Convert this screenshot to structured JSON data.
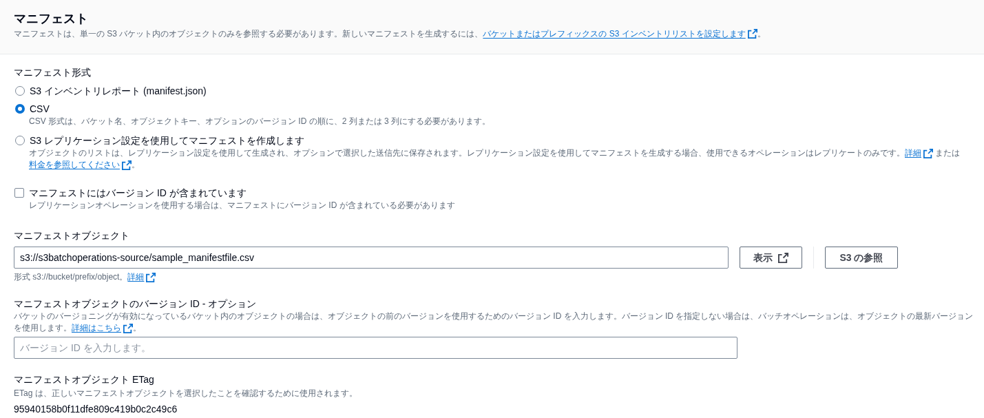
{
  "header": {
    "title": "マニフェスト",
    "description": [
      {
        "kind": "text",
        "text": "マニフェストは、単一の S3 バケット内のオブジェクトのみを参照する必要があります。新しいマニフェストを生成するには、"
      },
      {
        "kind": "link",
        "text": "バケットまたはプレフィックスの S3 インベントリリストを設定します"
      },
      {
        "kind": "text",
        "text": "。"
      }
    ]
  },
  "manifest_format": {
    "label": "マニフェスト形式",
    "options": [
      {
        "label": "S3 インベントリレポート (manifest.json)",
        "selected": false
      },
      {
        "label": "CSV",
        "selected": true,
        "description": [
          {
            "kind": "text",
            "text": "CSV 形式は、バケット名、オブジェクトキー、オプションのバージョン ID の順に、2 列または 3 列にする必要があります。"
          }
        ]
      },
      {
        "label": "S3 レプリケーション設定を使用してマニフェストを作成します",
        "selected": false,
        "description": [
          {
            "kind": "text",
            "text": "オブジェクトのリストは、レプリケーション設定を使用して生成され、オプションで選択した送信先に保存されます。レプリケーション設定を使用してマニフェストを生成する場合、使用できるオペレーションはレプリケートのみです。"
          },
          {
            "kind": "link",
            "text": "詳細"
          },
          {
            "kind": "text",
            "text": " または "
          },
          {
            "kind": "link",
            "text": "料金を参照してください"
          },
          {
            "kind": "text",
            "text": "。"
          }
        ]
      }
    ]
  },
  "version_checkbox": {
    "label": "マニフェストにはバージョン ID が含まれています",
    "checked": false,
    "description": [
      {
        "kind": "text",
        "text": "レプリケーションオペレーションを使用する場合は、マニフェストにバージョン ID が含まれている必要があります"
      }
    ]
  },
  "manifest_object": {
    "label": "マニフェストオブジェクト",
    "value": "s3://s3batchoperations-source/sample_manifestfile.csv",
    "buttons": [
      {
        "label": "表示",
        "kind": "external"
      },
      {
        "label": "S3 の参照",
        "kind": "plain"
      }
    ],
    "help": [
      {
        "kind": "text",
        "text": "形式 s3://bucket/prefix/object。"
      },
      {
        "kind": "link",
        "text": "詳細"
      }
    ]
  },
  "version_id": {
    "label": "マニフェストオブジェクトのバージョン ID - オプション",
    "description": [
      {
        "kind": "text",
        "text": "バケットのバージョニングが有効になっているバケット内のオブジェクトの場合は、オブジェクトの前のバージョンを使用するためのバージョン ID を入力します。バージョン ID を指定しない場合は、バッチオペレーションは、オブジェクトの最新バージョンを使用します。"
      },
      {
        "kind": "link",
        "text": "詳細はこちら"
      },
      {
        "kind": "text",
        "text": "。"
      }
    ],
    "placeholder": "バージョン ID を入力します。"
  },
  "etag": {
    "label": "マニフェストオブジェクト ETag",
    "description": [
      {
        "kind": "text",
        "text": "ETag は、正しいマニフェストオブジェクトを選択したことを確認するために使用されます。"
      }
    ],
    "value": "95940158b0f11dfe809c419b0c2c49c6"
  }
}
